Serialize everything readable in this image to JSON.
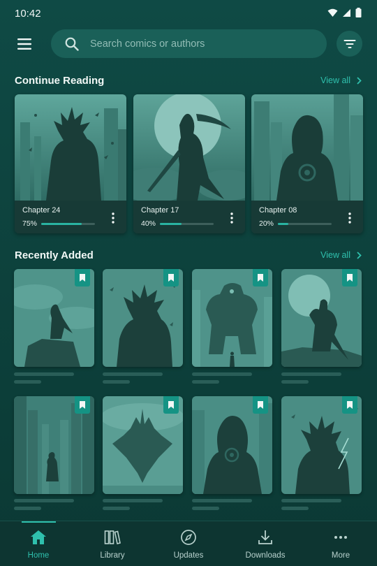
{
  "status_bar": {
    "time": "10:42"
  },
  "search": {
    "placeholder": "Search comics or authors"
  },
  "continue_reading": {
    "title": "Continue Reading",
    "view_all": "View all",
    "items": [
      {
        "chapter": "Chapter 24",
        "progress_label": "75%",
        "progress": 0.75
      },
      {
        "chapter": "Chapter 17",
        "progress_label": "40%",
        "progress": 0.4
      },
      {
        "chapter": "Chapter 08",
        "progress_label": "20%",
        "progress": 0.2
      }
    ]
  },
  "recently_added": {
    "title": "Recently Added",
    "view_all": "View all"
  },
  "bottom_nav": {
    "items": [
      {
        "label": "Home",
        "icon": "home-icon",
        "active": true
      },
      {
        "label": "Library",
        "icon": "library-icon",
        "active": false
      },
      {
        "label": "Updates",
        "icon": "compass-icon",
        "active": false
      },
      {
        "label": "Downloads",
        "icon": "download-icon",
        "active": false
      },
      {
        "label": "More",
        "icon": "more-horizontal-icon",
        "active": false
      }
    ]
  },
  "colors": {
    "accent": "#2fc0ad",
    "background": "#0f4a45",
    "surface": "#1a6058",
    "bookmark": "#159384"
  }
}
